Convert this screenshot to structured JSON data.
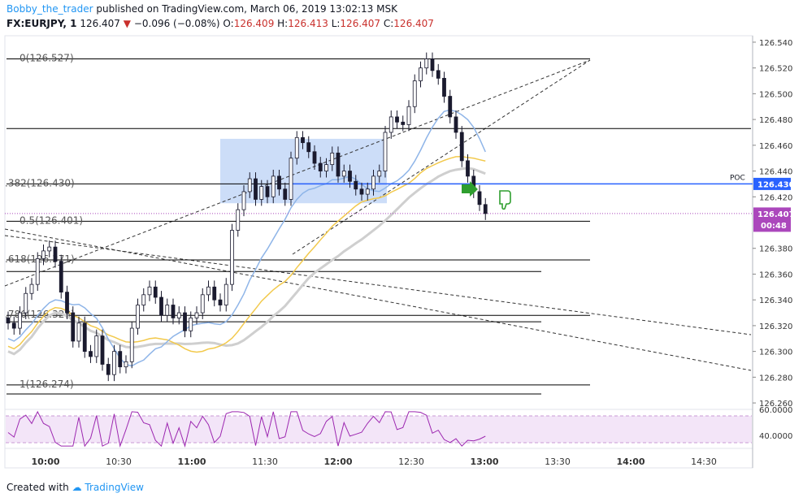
{
  "header": {
    "username": "Bobby_the_trader",
    "published": "published on TradingView.com, March 06, 2019 13:02:13 MSK",
    "symbol": "FX:EURJPY, 1",
    "last": "126.407",
    "change": "−0.096 (−0.08%)",
    "o_label": "O:",
    "o_value": "126.409",
    "h_label": "H:",
    "h_value": "126.413",
    "l_label": "L:",
    "l_value": "126.407",
    "c_label": "C:",
    "c_value": "126.407"
  },
  "footer": {
    "created_with": "Created with",
    "brand": "TradingView"
  },
  "colors": {
    "candle": "#1a1a2e",
    "fib": "#000000",
    "poc": "#2962ff",
    "zone": "#bbd1f5",
    "ma_blue": "#8fb5e8",
    "ma_yellow": "#f2c94c",
    "ma_gray": "#cfcfcf",
    "rsi": "#9c27b0",
    "rsi_band": "#f3e5f8",
    "price_label": "#ab47bc",
    "thumb": "#2e9e2e"
  },
  "chart_data": {
    "type": "candlestick",
    "y_ticks": [
      "126.540",
      "126.520",
      "126.500",
      "126.480",
      "126.460",
      "126.440",
      "126.420",
      "126.380",
      "126.360",
      "126.340",
      "126.320",
      "126.300",
      "126.280",
      "126.260"
    ],
    "ylim": [
      126.255,
      126.545
    ],
    "x_ticks": [
      "10:00",
      "10:30",
      "11:00",
      "11:30",
      "12:00",
      "12:30",
      "13:00",
      "13:30",
      "14:00",
      "14:30"
    ],
    "fib_levels": [
      {
        "label": "0(126.527)",
        "value": 126.527
      },
      {
        "label": ".382(126.430)",
        "value": 126.43
      },
      {
        "label": "0.5(126.401)",
        "value": 126.401
      },
      {
        "label": ".618(126.371)",
        "value": 126.371
      },
      {
        "label": ".786(126.328)",
        "value": 126.328
      },
      {
        "label": "1(126.274)",
        "value": 126.274
      }
    ],
    "extra_levels": [
      126.473,
      126.362,
      126.323,
      126.267
    ],
    "poc": {
      "label": "POC",
      "value": "126.430"
    },
    "last_price": {
      "value": "126.407",
      "countdown": "00:48"
    },
    "rsi_ticks": [
      "60.0000",
      "40.0000"
    ],
    "close_series": [
      126.322,
      126.318,
      126.33,
      126.345,
      126.352,
      126.372,
      126.378,
      126.381,
      126.37,
      126.346,
      126.33,
      126.308,
      126.322,
      126.3,
      126.296,
      126.312,
      126.29,
      126.282,
      126.3,
      126.288,
      126.292,
      126.318,
      126.336,
      126.344,
      126.35,
      126.342,
      126.328,
      126.336,
      126.326,
      126.33,
      126.316,
      126.326,
      126.33,
      126.344,
      126.35,
      126.34,
      126.336,
      126.352,
      126.394,
      126.41,
      126.424,
      126.434,
      126.418,
      126.428,
      126.42,
      126.436,
      126.426,
      126.418,
      126.45,
      126.466,
      126.462,
      126.455,
      126.446,
      126.44,
      126.445,
      126.454,
      126.436,
      126.44,
      126.432,
      126.426,
      126.422,
      126.426,
      126.436,
      126.44,
      126.47,
      126.482,
      126.478,
      126.476,
      126.49,
      126.51,
      126.52,
      126.527,
      126.518,
      126.512,
      126.498,
      126.482,
      126.47,
      126.448,
      126.436,
      126.424,
      126.414,
      126.407
    ],
    "zone": {
      "from": 126.415,
      "to": 126.465
    }
  }
}
